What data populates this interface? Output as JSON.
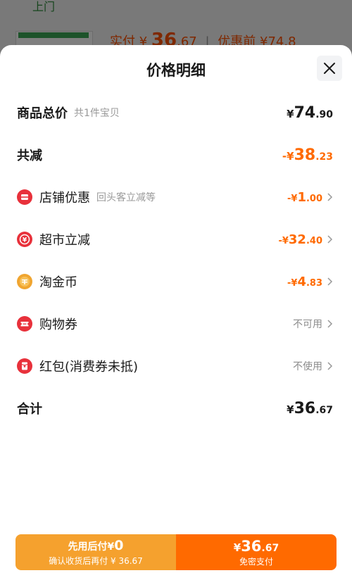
{
  "background": {
    "top_label": "上门",
    "price_prefix": "实付",
    "price_currency": "¥",
    "price_int": "36",
    "price_dec": ".67",
    "price_sep": "|",
    "before_discount": "优惠前 ¥74.8"
  },
  "sheet": {
    "title": "价格明细"
  },
  "items": {
    "total": {
      "label": "商品总价",
      "sub": "共1件宝贝",
      "cur": "¥",
      "int": "74",
      "dec": ".90"
    },
    "reduce": {
      "label": "共减",
      "cur": "-¥",
      "int": "38",
      "dec": ".23"
    },
    "shop": {
      "label": "店铺优惠",
      "sub": "回头客立减等",
      "cur": "-¥",
      "int": "1",
      "dec": ".00",
      "icon": "shop-coupon-icon",
      "color": "#e8313b"
    },
    "market": {
      "label": "超市立减",
      "cur": "-¥",
      "int": "32",
      "dec": ".40",
      "icon": "supermarket-discount-icon",
      "color": "#e8313b"
    },
    "coin": {
      "label": "淘金币",
      "cur": "-¥",
      "int": "4",
      "dec": ".83",
      "icon": "gold-coin-icon",
      "color": "#f0a530"
    },
    "voucher": {
      "label": "购物券",
      "status": "不可用",
      "icon": "voucher-icon",
      "color": "#e8313b"
    },
    "redpacket": {
      "label": "红包(消费券未抵)",
      "status": "不使用",
      "icon": "red-packet-icon",
      "color": "#e8313b"
    },
    "sum": {
      "label": "合计",
      "cur": "¥",
      "int": "36",
      "dec": ".67"
    }
  },
  "pay": {
    "later_line1": "先用后付",
    "later_cur": "¥",
    "later_zero": "0",
    "later_line2": "确认收货后再付 ¥ 36.67",
    "now_cur": "¥",
    "now_int": "36",
    "now_dec": ".67",
    "now_line2": "免密支付"
  },
  "colors": {
    "accent": "#ff6a00",
    "pay_later": "#f5a12e",
    "pay_now": "#ff6a00"
  }
}
